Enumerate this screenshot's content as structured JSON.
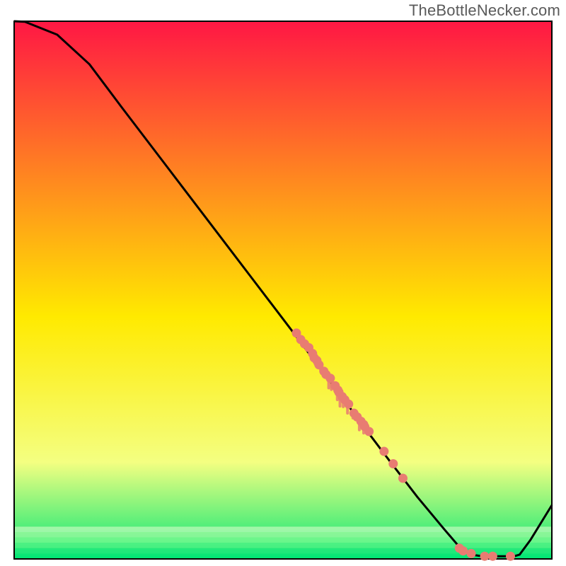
{
  "watermark": "TheBottleNecker.com",
  "chart_data": {
    "type": "line",
    "title": "",
    "xlabel": "",
    "ylabel": "",
    "xlim": [
      0,
      100
    ],
    "ylim": [
      0,
      100
    ],
    "curve": [
      {
        "x": 0,
        "y": 100.0
      },
      {
        "x": 2,
        "y": 99.9
      },
      {
        "x": 8,
        "y": 97.5
      },
      {
        "x": 14,
        "y": 92.0
      },
      {
        "x": 20,
        "y": 84.0
      },
      {
        "x": 28,
        "y": 73.5
      },
      {
        "x": 36,
        "y": 63.0
      },
      {
        "x": 44,
        "y": 52.5
      },
      {
        "x": 52,
        "y": 42.0
      },
      {
        "x": 58,
        "y": 34.0
      },
      {
        "x": 62,
        "y": 28.7
      },
      {
        "x": 66,
        "y": 23.3
      },
      {
        "x": 70,
        "y": 18.0
      },
      {
        "x": 75,
        "y": 11.5
      },
      {
        "x": 80,
        "y": 5.5
      },
      {
        "x": 83,
        "y": 2.0
      },
      {
        "x": 85,
        "y": 0.8
      },
      {
        "x": 87,
        "y": 0.5
      },
      {
        "x": 93,
        "y": 0.5
      },
      {
        "x": 94,
        "y": 0.8
      },
      {
        "x": 96,
        "y": 3.5
      },
      {
        "x": 100,
        "y": 10.0
      }
    ],
    "markers": [
      {
        "x": 52.5,
        "y": 42.0
      },
      {
        "x": 53.3,
        "y": 40.8
      },
      {
        "x": 54.0,
        "y": 40.0
      },
      {
        "x": 54.8,
        "y": 39.3
      },
      {
        "x": 55.5,
        "y": 38.2
      },
      {
        "x": 55.8,
        "y": 37.4
      },
      {
        "x": 56.3,
        "y": 36.9
      },
      {
        "x": 56.7,
        "y": 36.1
      },
      {
        "x": 57.6,
        "y": 34.9
      },
      {
        "x": 58.0,
        "y": 34.3
      },
      {
        "x": 58.8,
        "y": 33.6
      },
      {
        "x": 59.7,
        "y": 32.2
      },
      {
        "x": 60.2,
        "y": 31.4
      },
      {
        "x": 60.4,
        "y": 31.0
      },
      {
        "x": 61.0,
        "y": 30.2
      },
      {
        "x": 61.5,
        "y": 29.6
      },
      {
        "x": 62.2,
        "y": 28.8
      },
      {
        "x": 63.2,
        "y": 27.1
      },
      {
        "x": 63.8,
        "y": 26.4
      },
      {
        "x": 64.5,
        "y": 25.6
      },
      {
        "x": 65.0,
        "y": 25.0
      },
      {
        "x": 65.2,
        "y": 24.6
      },
      {
        "x": 66.0,
        "y": 23.7
      },
      {
        "x": 68.8,
        "y": 20.0
      },
      {
        "x": 70.5,
        "y": 17.7
      },
      {
        "x": 72.3,
        "y": 15.0
      },
      {
        "x": 82.8,
        "y": 2.0
      },
      {
        "x": 83.5,
        "y": 1.5
      },
      {
        "x": 85.0,
        "y": 1.0
      },
      {
        "x": 87.5,
        "y": 0.5
      },
      {
        "x": 89.0,
        "y": 0.5
      },
      {
        "x": 92.3,
        "y": 0.5
      }
    ],
    "marker_drips": [
      {
        "x": 56.0,
        "y": 37.7,
        "len": 1.5
      },
      {
        "x": 57.0,
        "y": 36.3,
        "len": 1.2
      },
      {
        "x": 58.5,
        "y": 34.0,
        "len": 2.2
      },
      {
        "x": 59.0,
        "y": 33.3,
        "len": 1.8
      },
      {
        "x": 60.1,
        "y": 31.6,
        "len": 2.0
      },
      {
        "x": 60.6,
        "y": 30.9,
        "len": 2.5
      },
      {
        "x": 61.2,
        "y": 30.0,
        "len": 1.7
      },
      {
        "x": 62.0,
        "y": 29.1,
        "len": 2.0
      },
      {
        "x": 63.0,
        "y": 27.5,
        "len": 1.3
      },
      {
        "x": 64.2,
        "y": 26.0,
        "len": 2.0
      },
      {
        "x": 65.0,
        "y": 25.0,
        "len": 1.6
      }
    ],
    "colors": {
      "curve": "#000000",
      "marker": "#e87c72",
      "marker_drip": "#e87c72",
      "gradient_top": "#ff1744",
      "gradient_mid_upper": "#ffea00",
      "gradient_mid_lower": "#f4ff81",
      "gradient_bottom": "#00e676",
      "border": "#000000"
    }
  }
}
